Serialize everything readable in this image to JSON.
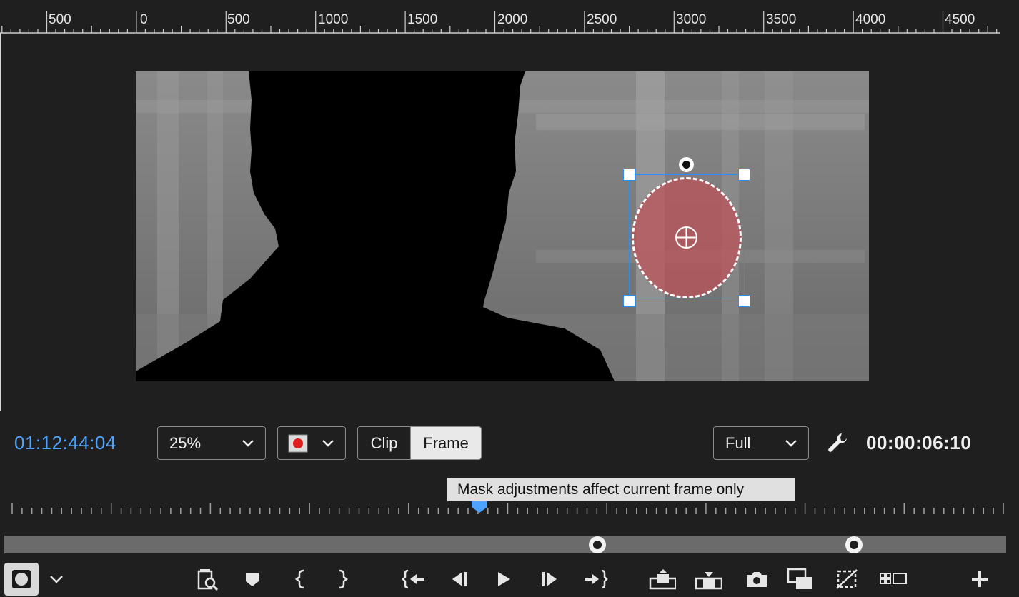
{
  "ruler": {
    "labels": [
      "500",
      "0",
      "500",
      "1000",
      "1500",
      "2000",
      "2500",
      "3000",
      "3500",
      "4000",
      "4500"
    ]
  },
  "controls": {
    "timecode_current": "01:12:44:04",
    "zoom_value": "25%",
    "mask_color": "#e01e1e",
    "segment_clip": "Clip",
    "segment_frame": "Frame",
    "resolution_value": "Full",
    "timecode_duration": "00:00:06:10"
  },
  "tooltip": {
    "text": "Mask adjustments affect current frame only"
  },
  "colors": {
    "accent": "#4da3ff",
    "selection": "#2e8ef0",
    "mask_fill": "#be5058"
  },
  "transport": {
    "icons": [
      "mask-tool-icon",
      "chevron-down-icon",
      "zoom-search-icon",
      "marker-icon",
      "mark-in-icon",
      "mark-out-icon",
      "go-to-in-icon",
      "step-back-icon",
      "play-icon",
      "step-forward-icon",
      "go-to-out-icon",
      "insert-icon",
      "overwrite-icon",
      "export-frame-icon",
      "comparison-view-icon",
      "toggle-proxies-icon",
      "multi-camera-icon",
      "add-button-icon"
    ]
  }
}
